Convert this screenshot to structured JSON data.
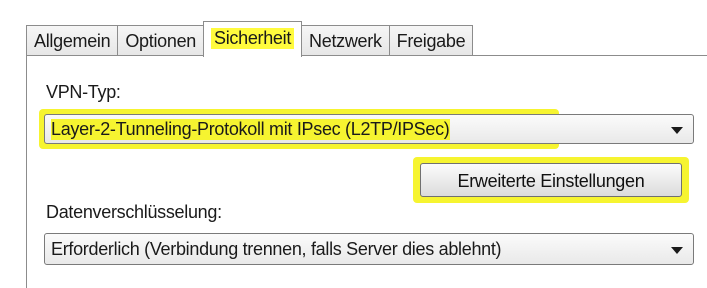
{
  "tabs": [
    {
      "label": "Allgemein",
      "active": false
    },
    {
      "label": "Optionen",
      "active": false
    },
    {
      "label": "Sicherheit",
      "active": true
    },
    {
      "label": "Netzwerk",
      "active": false
    },
    {
      "label": "Freigabe",
      "active": false
    }
  ],
  "vpn": {
    "label": "VPN-Typ:",
    "selected": "Layer-2-Tunneling-Protokoll mit IPsec (L2TP/IPSec)"
  },
  "advanced_button": {
    "label": "Erweiterte Einstellungen"
  },
  "encryption": {
    "label": "Datenverschlüsselung:",
    "selected": "Erforderlich (Verbindung trennen, falls Server dies ablehnt)"
  },
  "highlight_color": "#f6f430"
}
